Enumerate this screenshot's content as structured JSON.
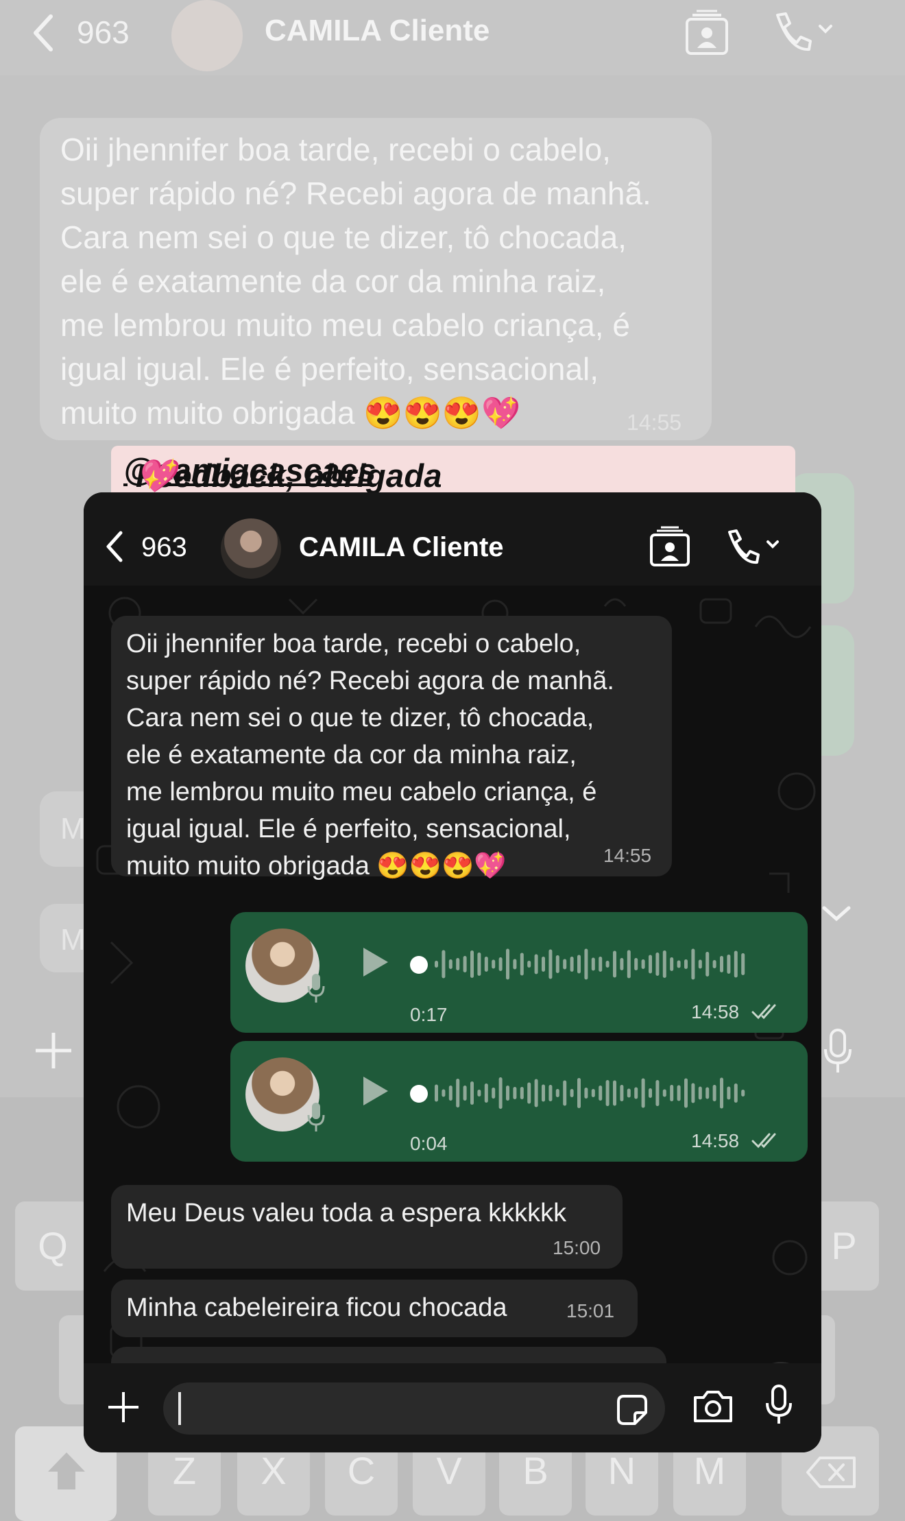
{
  "background": {
    "header": {
      "count": "963",
      "contact_name": "CAMILA Cliente"
    },
    "message": {
      "text": "Oii jhennifer boa tarde, recebi o cabelo,\nsuper rápido né? Recebi agora de manhã.\nCara nem sei o que te dizer, tô chocada,\nele é exatamente da cor da minha raiz,\nme lembrou muito meu cabelo criança, é\nigual igual. Ele é perfeito, sensacional,\nmuito muito obrigada 😍😍😍💖",
      "time": "14:55"
    },
    "side_letters": [
      "M",
      "M"
    ],
    "keyboard": {
      "row1": [
        "Q",
        "P"
      ],
      "row3": [
        "Z",
        "X",
        "C",
        "V",
        "B",
        "N",
        "M"
      ]
    }
  },
  "caption": {
    "text": "Feedback, obrigada ",
    "handle": "@camigcascaes",
    "emoji": " 💖"
  },
  "phone": {
    "header": {
      "count": "963",
      "contact_name": "CAMILA Cliente"
    },
    "messages": [
      {
        "direction": "in",
        "text": "Oii jhennifer boa tarde, recebi o cabelo,\nsuper rápido né? Recebi agora de manhã.\nCara nem sei o que te dizer, tô chocada,\nele é exatamente da cor da minha raiz,\nme lembrou muito meu cabelo criança, é\nigual igual. Ele é perfeito, sensacional,\nmuito muito obrigada 😍😍😍💖",
        "time": "14:55"
      },
      {
        "direction": "out",
        "type": "voice",
        "duration": "0:17",
        "time": "14:58",
        "status": "read",
        "played_fraction": 0
      },
      {
        "direction": "out",
        "type": "voice",
        "duration": "0:04",
        "time": "14:58",
        "status": "read",
        "played_fraction": 0
      },
      {
        "direction": "in",
        "text": "Meu Deus valeu toda a espera kkkkkk",
        "time": "15:00"
      },
      {
        "direction": "in",
        "text": "Minha cabeleireira ficou chocada",
        "time": "15:01"
      }
    ]
  },
  "colors": {
    "incoming_bubble": "#262626",
    "outgoing_bubble": "#1f5a3a",
    "caption_bg": "#f6dede"
  }
}
